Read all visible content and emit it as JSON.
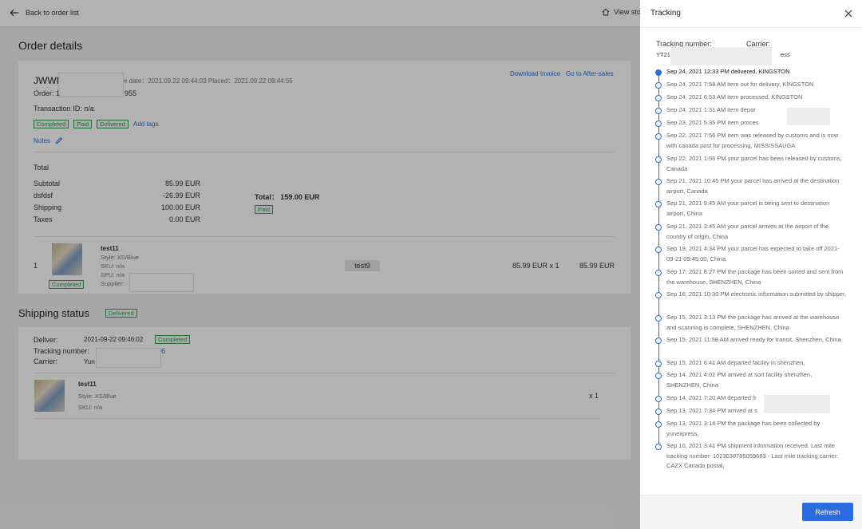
{
  "topbar": {
    "back_label": "Back to order list",
    "view_store_label": "View sto"
  },
  "order_details": {
    "title": "Order details",
    "order_name": "JWWI",
    "date_line": "e date：2021.09.22 09:44:03   Placed：2021.09.22 09:44:55",
    "order_label": "Order: 1",
    "order_tail": "955",
    "transaction": "Transaction ID: n/a",
    "tags": [
      "Completed",
      "Paid",
      "Delivered"
    ],
    "add_tags": "Add tags",
    "notes": "Notes",
    "download_invoice": "Download Invoice",
    "after_sales": "Go to After-sales",
    "total_heading": "Total",
    "totals": [
      {
        "label": "Subtotal",
        "value": "85.99 EUR"
      },
      {
        "label": "dsfdsf",
        "value": "-26.99 EUR"
      },
      {
        "label": "Shipping",
        "value": "100.00 EUR"
      },
      {
        "label": "Taxes",
        "value": "0.00 EUR"
      }
    ],
    "grand_total_label": "Total：",
    "grand_total_value": "159.00 EUR",
    "paid_tag": "Paid",
    "item": {
      "index": "1",
      "name": "test11",
      "style": "Style: XS/Blue",
      "sku": "SKU: n/a",
      "spu": "SPU: n/a",
      "supplier": "Supplier: ",
      "status_tag": "Completed",
      "chip": "test9",
      "price_qty": "85.99 EUR x 1",
      "line_total": "85.99 EUR"
    }
  },
  "shipping": {
    "title": "Shipping status",
    "status_tag": "Delivered",
    "deliver_label": "Deliver:",
    "deliver_date": "2021-09-22 09:46:02",
    "deliver_tag": "Completed",
    "tracking_label": "Tracking number:",
    "tracking_tail": "6",
    "carrier_label": "Carrier:",
    "carrier_value": "Yun",
    "item": {
      "name": "test11",
      "style": "Style: XS/Blue",
      "sku": "SKU: n/a",
      "qty": "x 1"
    }
  },
  "tracking": {
    "title": "Tracking",
    "tracking_number_label": "Tracking number:",
    "carrier_label": "Carrier:",
    "tracking_number_value": "YT21",
    "carrier_value": "ess",
    "refresh_label": "Refresh",
    "events": [
      "Sep 24, 2021 12:33 PM delivered, KINGSTON",
      "Sep 24, 2021 7:58 AM item out for delivery, KINGSTON",
      "Sep 24, 2021 6:53 AM item processed, KINGSTON",
      "Sep 24, 2021 1:31 AM item depar",
      "Sep 23, 2021 5:35 PM item proces",
      "Sep 22, 2021 7:56 PM item was released by customs and is now with canada post for processing, MISSISSAUGA",
      "Sep 22, 2021 1:56 PM your parcel has been released by customs, Canada",
      "Sep 21, 2021 10:45 PM your parcel has arrived at the destination airport, Canada",
      "Sep 21, 2021 9:45 AM your parcel is being sent to destination airport, China",
      "Sep 21, 2021 3:45 AM your parcel arrives at the airport of the country of origin, China",
      "Sep 19, 2021 4:34 PM your parcel has expected to take off 2021-09-21 09:45:00, China",
      "Sep 17, 2021 8:27 PM the package has been sorted and sent from the warehouse, SHENZHEN, China",
      "Sep 16, 2021 10:30 PM electronic information submitted by shipper,",
      "Sep 15, 2021 3:13 PM the package has arrived at the warehouse and scanning is complete, SHENZHEN, China",
      "Sep 15, 2021 11:58 AM arrived ready for transit, Shenzhen, China",
      "Sep 15, 2021 6:41 AM departed facility in shenzhen,",
      "Sep 14, 2021 4:02 PM arrived at sort facility shenzhen, SHENZHEN, China",
      "Sep 14, 2021 7:20 AM departed fr",
      "Sep 13, 2021 7:34 PM arrived at s",
      "Sep 13, 2021 3:14 PM the package has been collected by yunexpress,",
      "Sep 10, 2021 3:41 PM shipment information received. Last mile tracking number: 1023038785059683 - Last mile tracking carrier: CAZX Canada postal,"
    ]
  }
}
